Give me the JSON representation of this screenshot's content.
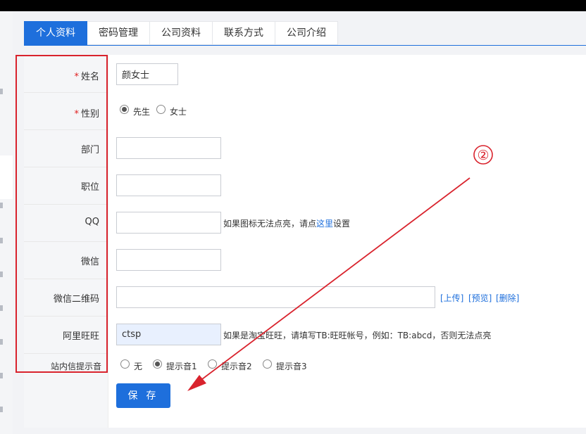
{
  "tabs": [
    "个人资料",
    "密码管理",
    "公司资料",
    "联系方式",
    "公司介绍"
  ],
  "labels": {
    "name": "姓名",
    "gender": "性别",
    "department": "部门",
    "position": "职位",
    "qq": "QQ",
    "wechat": "微信",
    "wechat_qr": "微信二维码",
    "aliwangwang": "阿里旺旺",
    "notify_sound": "站内信提示音",
    "required_mark": "*"
  },
  "fields": {
    "name_value": "颜女士",
    "department_value": "",
    "position_value": "",
    "qq_value": "",
    "wechat_value": "",
    "wechat_qr_value": "",
    "aliwangwang_value": "ctsp"
  },
  "gender": {
    "options": [
      "先生",
      "女士"
    ],
    "selected": "先生"
  },
  "qq_hint": {
    "before": "如果图标无法点亮，请点",
    "link": "这里",
    "after": "设置"
  },
  "qr_links": [
    "[上传]",
    "[预览]",
    "[删除]"
  ],
  "aliwangwang_hint": "如果是淘宝旺旺，请填写TB:旺旺帐号，例如：TB:abcd，否则无法点亮",
  "notify_sound": {
    "options": [
      "无",
      "提示音1",
      "提示音2",
      "提示音3"
    ],
    "selected": "提示音1"
  },
  "save_label": "保 存",
  "annotation": {
    "step_marker": "②",
    "color": "#d9232d"
  },
  "colors": {
    "accent": "#1e6fdc",
    "required": "#e02020",
    "autofill": "#e8f0fe"
  }
}
